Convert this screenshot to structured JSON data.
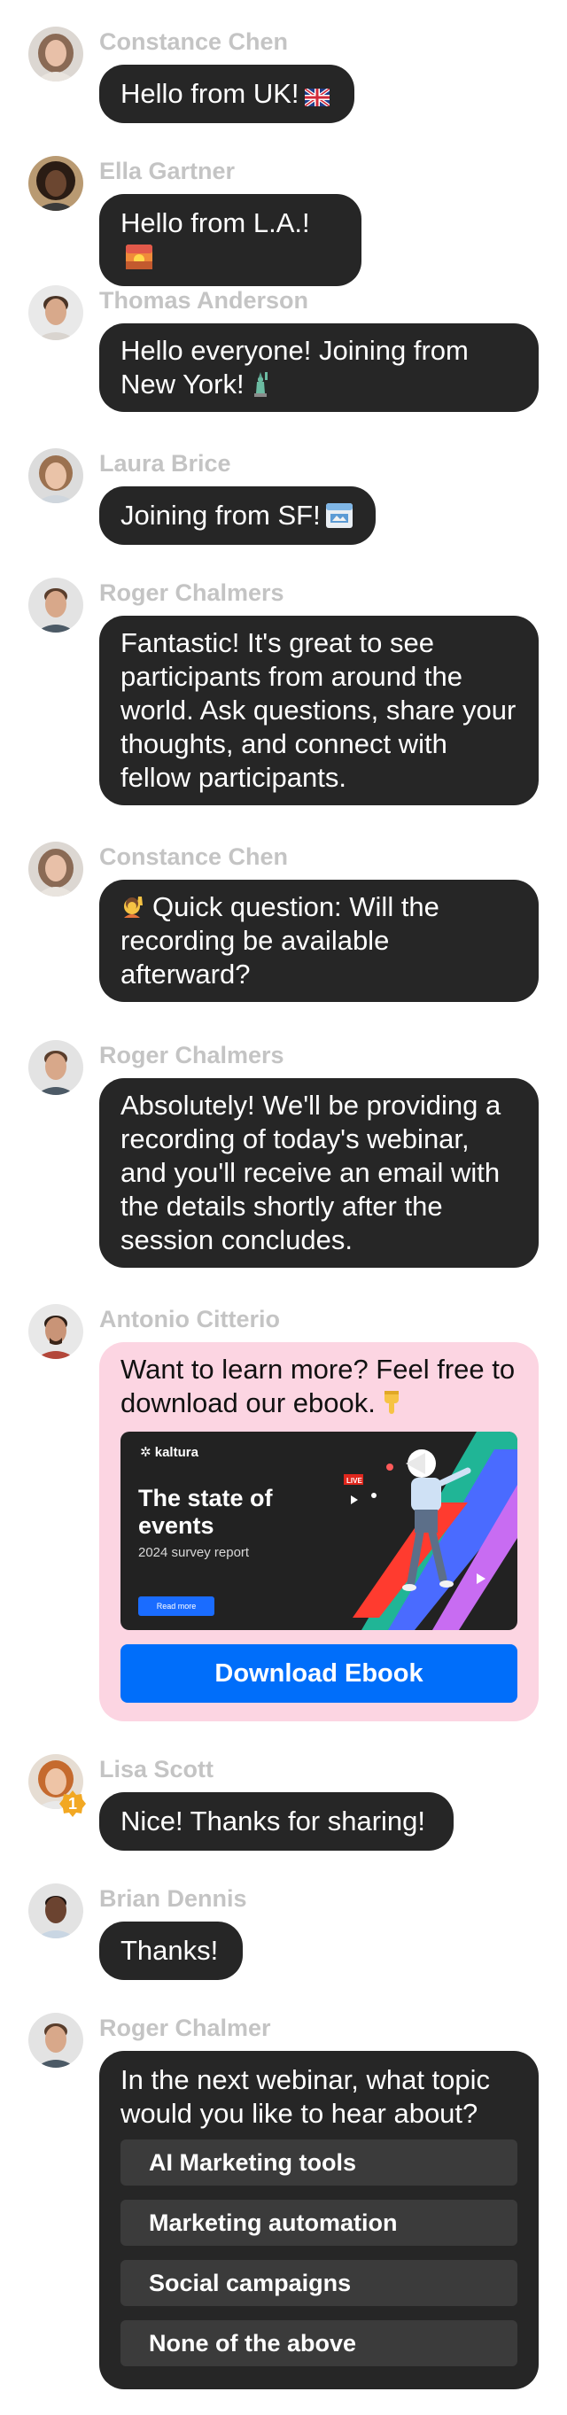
{
  "messages": [
    {
      "name": "Constance Chen",
      "text": "Hello from UK!",
      "emoji": "uk-flag-icon"
    },
    {
      "name": "Ella Gartner",
      "text": "Hello from L.A.!",
      "emoji": "sunset-icon"
    },
    {
      "name": "Thomas Anderson",
      "text": "Hello everyone! Joining from New York!",
      "emoji": "statue-of-liberty-icon"
    },
    {
      "name": "Laura Brice",
      "text": "Joining from SF!",
      "emoji": "calendar-icon"
    },
    {
      "name": "Roger Chalmers",
      "text": "Fantastic! It's great to see participants from around the world. Ask questions, share your thoughts, and connect with fellow participants."
    },
    {
      "name": "Constance Chen",
      "text": "Quick question: Will the recording be available afterward?",
      "emoji": "raising-hand-icon"
    },
    {
      "name": "Roger Chalmers",
      "text": "Absolutely! We'll be providing a recording of today's webinar, and you'll receive an email with the details shortly after the session concludes."
    },
    {
      "name": "Antonio Citterio",
      "text": "Want to learn more? Feel free to download our ebook.",
      "emoji": "pointing-down-icon",
      "card": {
        "brand": "kaltura",
        "title": "The state of events",
        "subtitle": "2024 survey report",
        "read_more": "Read more",
        "live_badge": "LIVE",
        "button": "Download Ebook"
      }
    },
    {
      "name": "Lisa Scott",
      "text": "Nice! Thanks for sharing!",
      "badge": "1"
    },
    {
      "name": "Brian Dennis",
      "text": "Thanks!"
    },
    {
      "name": "Roger Chalmer",
      "poll": {
        "question": "In the next webinar, what topic would you like to hear about?",
        "options": [
          "AI Marketing tools",
          "Marketing automation",
          "Social campaigns",
          "None of the above"
        ]
      }
    }
  ],
  "colors": {
    "bubble": "#262626",
    "name": "#c4c4c4",
    "promo_bg": "#fcd5e2",
    "accent": "#006efa",
    "poll_option": "#3b3b3b",
    "badge": "#f2a823"
  }
}
